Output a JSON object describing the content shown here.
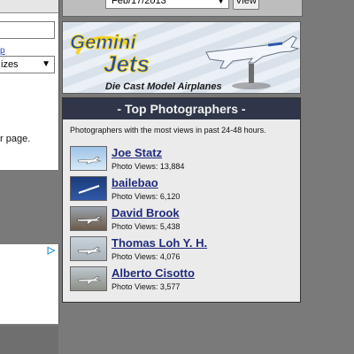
{
  "left_panel": {
    "link_text": "p",
    "select_value": "izes",
    "footer_text": "r page."
  },
  "left_ad": {
    "ad_choices_icon": "adchoices-icon"
  },
  "top_bar": {
    "date_value": "Feb/17/2013",
    "view_button_label": "View"
  },
  "ad_banner": {
    "logo_line1": "Gemini",
    "logo_line2": "Jets",
    "caption": "Die Cast Model Airplanes",
    "colors": {
      "logo_blue": "#1f4aa8",
      "logo_yellow": "#f5d21a"
    }
  },
  "top_photographers": {
    "title": "- Top Photographers -",
    "subtitle": "Photographers with the most views in past 24-48 hours.",
    "views_prefix": "Photo Views:",
    "items": [
      {
        "name": "Joe Statz",
        "views": "13,884"
      },
      {
        "name": "bailebao",
        "views": "6,120"
      },
      {
        "name": "David Brook",
        "views": "5,438"
      },
      {
        "name": "Thomas Loh Y. H.",
        "views": "4,076"
      },
      {
        "name": "Alberto Cisotto",
        "views": "3,577"
      }
    ]
  }
}
